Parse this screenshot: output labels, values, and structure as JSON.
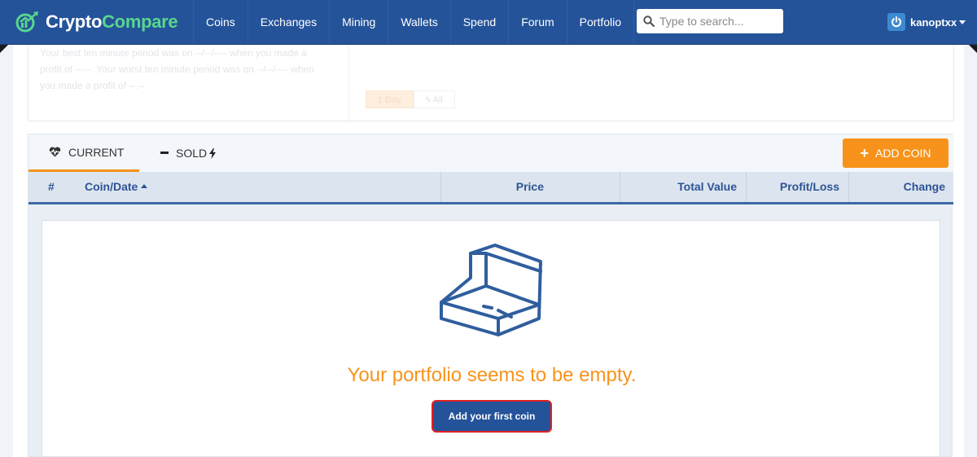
{
  "brand": {
    "name_part1": "Crypto",
    "name_part2": "Compare",
    "logo_icon": "chart-circle-logo-icon"
  },
  "nav": {
    "items": [
      "Coins",
      "Exchanges",
      "Mining",
      "Wallets",
      "Spend",
      "Forum",
      "Portfolio"
    ]
  },
  "search": {
    "placeholder": "Type to search...",
    "value": "",
    "icon": "search-icon"
  },
  "user": {
    "name": "kanoptxx",
    "icon": "power-icon"
  },
  "summary": {
    "text": "Your best ten minute period was on --/--/---- when you made a profit of --.--. Your worst ten minute period was on --/--/---- when you made a profit of --.--.",
    "range_buttons": [
      "1 Day",
      "All"
    ],
    "selected_range": "1 Day"
  },
  "tabs": {
    "current": "CURRENT",
    "sold": "SOLD",
    "current_icon": "heart-pulse-icon",
    "sold_icon": "lightning-icon"
  },
  "add_coin_label": "ADD COIN",
  "table": {
    "columns": [
      "#",
      "Coin/Date",
      "Price",
      "Total Value",
      "Profit/Loss",
      "Change"
    ],
    "sorted_column": "Coin/Date",
    "sort_direction": "asc"
  },
  "empty_state": {
    "icon": "open-box-icon",
    "message": "Your portfolio seems to be empty.",
    "button_label": "Add your first coin"
  },
  "colors": {
    "navbar": "#245399",
    "accent_orange": "#f7931a",
    "brand_green": "#58d68d",
    "header_text": "#2e5394"
  }
}
